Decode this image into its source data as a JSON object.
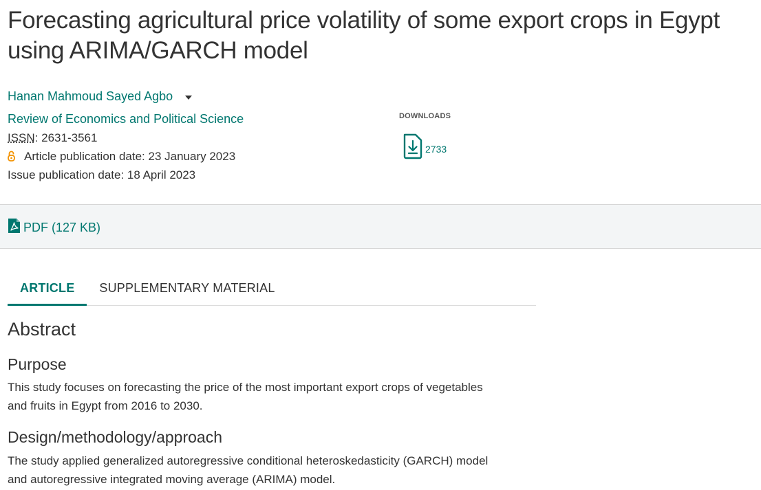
{
  "article": {
    "title": "Forecasting agricultural price volatility of some export crops in Egypt using ARIMA/GARCH model",
    "author": "Hanan Mahmoud Sayed Agbo",
    "journal": "Review of Economics and Political Science",
    "issn_label": "ISSN",
    "issn_value": ": 2631-3561",
    "article_pub_date": "Article publication date: 23 January 2023",
    "issue_pub_date": "Issue publication date: 18 April 2023"
  },
  "downloads": {
    "label": "DOWNLOADS",
    "count": "2733",
    "icon": "download-file-icon"
  },
  "pdf": {
    "label": "PDF (127 KB)",
    "icon": "pdf-icon"
  },
  "tabs": [
    {
      "label": "ARTICLE",
      "active": true
    },
    {
      "label": "SUPPLEMENTARY MATERIAL",
      "active": false
    }
  ],
  "abstract": {
    "heading": "Abstract",
    "sections": [
      {
        "heading": "Purpose",
        "text_lines": [
          "This study focuses on forecasting the price of the most important export crops of vegetables",
          "and fruits in Egypt from 2016 to 2030."
        ]
      },
      {
        "heading": "Design/methodology/approach",
        "text_lines": [
          "The study applied generalized autoregressive conditional heteroskedasticity (GARCH) model",
          "and autoregressive integrated moving average (ARIMA) model."
        ]
      }
    ]
  },
  "colors": {
    "accent": "#00776f",
    "open_access": "#f39200",
    "band_bg": "#f3f5f6"
  }
}
